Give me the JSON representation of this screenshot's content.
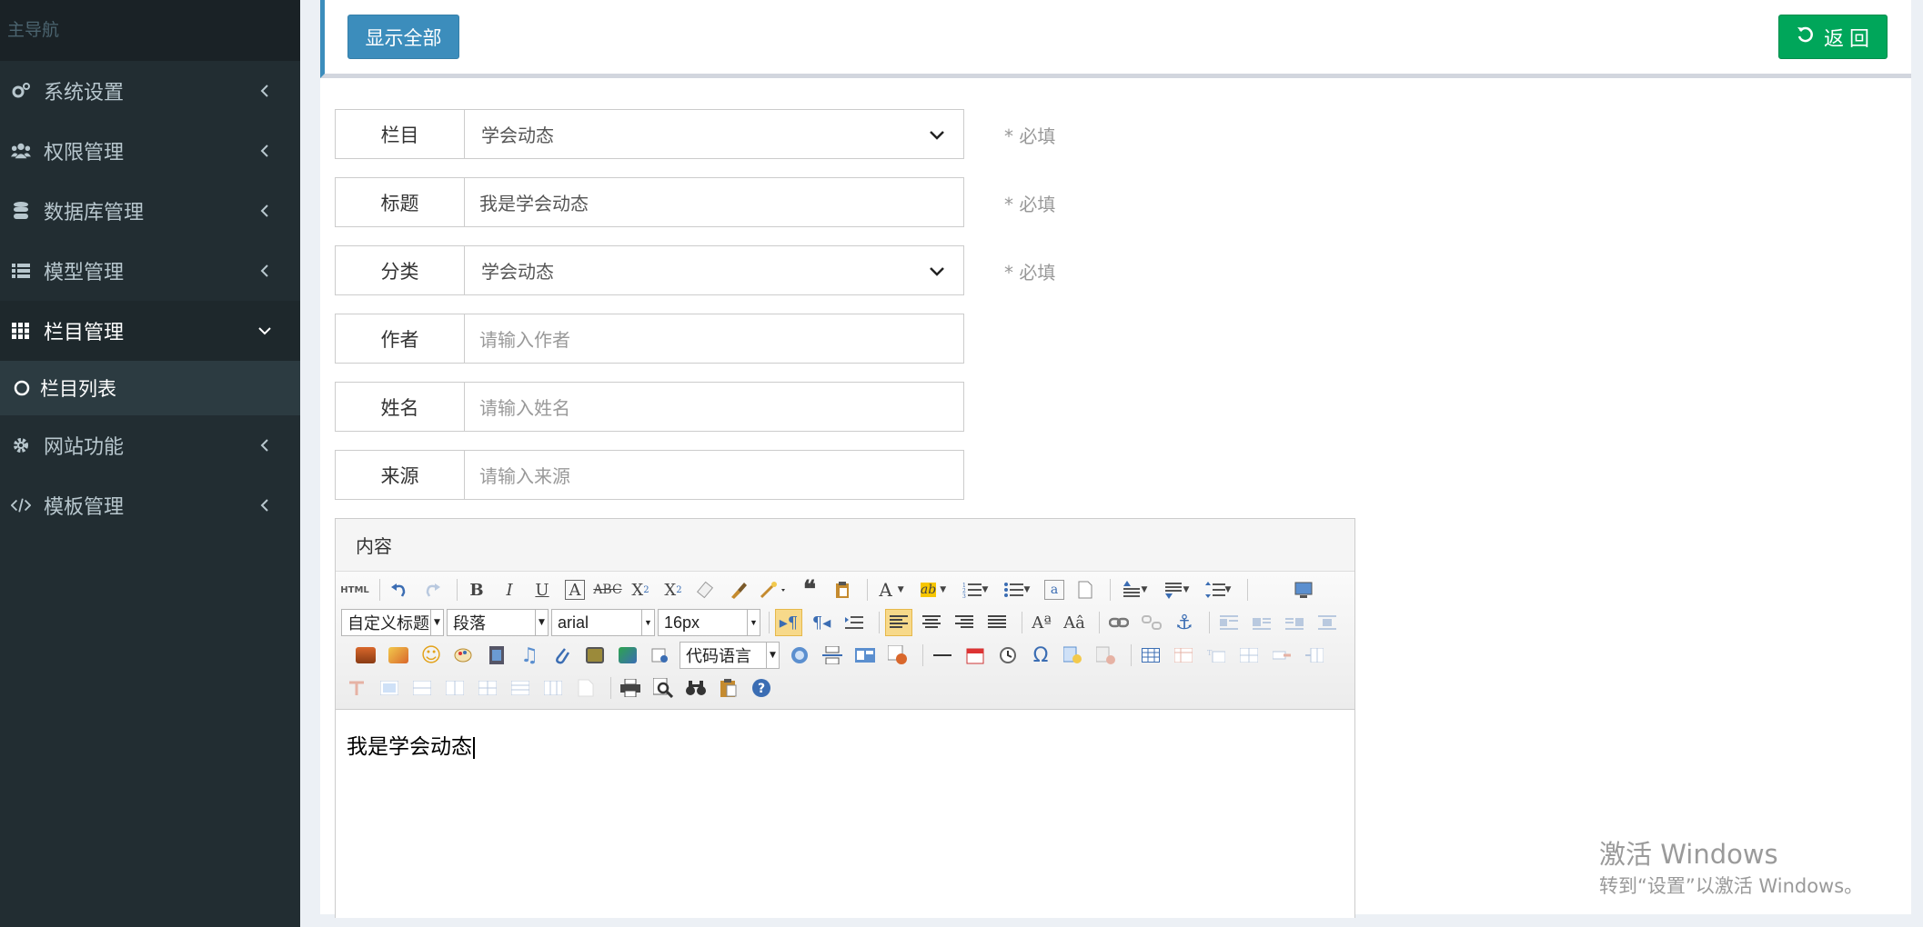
{
  "sidebar": {
    "header": "主导航",
    "items": [
      {
        "label": "系统设置",
        "icon": "gears-icon"
      },
      {
        "label": "权限管理",
        "icon": "users-icon"
      },
      {
        "label": "数据库管理",
        "icon": "database-icon"
      },
      {
        "label": "模型管理",
        "icon": "list-icon"
      },
      {
        "label": "栏目管理",
        "icon": "grid-icon",
        "expanded": true
      },
      {
        "label": "网站功能",
        "icon": "gear-icon"
      },
      {
        "label": "模板管理",
        "icon": "code-icon"
      }
    ],
    "submenu": {
      "label": "栏目列表",
      "icon": "circle-icon"
    }
  },
  "toolbar": {
    "show_all": "显示全部",
    "back": "返 回"
  },
  "form": {
    "required": "* 必填",
    "column": {
      "label": "栏目",
      "value": "学会动态"
    },
    "title": {
      "label": "标题",
      "value": "我是学会动态"
    },
    "category": {
      "label": "分类",
      "value": "学会动态"
    },
    "author": {
      "label": "作者",
      "placeholder": "请输入作者"
    },
    "name": {
      "label": "姓名",
      "placeholder": "请输入姓名"
    },
    "source": {
      "label": "来源",
      "placeholder": "请输入来源"
    },
    "content_label": "内容"
  },
  "editor": {
    "html_btn": "HTML",
    "heading_select": "自定义标题",
    "paragraph_select": "段落",
    "font_select": "arial",
    "size_select": "16px",
    "code_select": "代码语言",
    "body_text": "我是学会动态"
  },
  "watermark": {
    "line1": "激活 Windows",
    "line2": "转到“设置”以激活 Windows。"
  }
}
